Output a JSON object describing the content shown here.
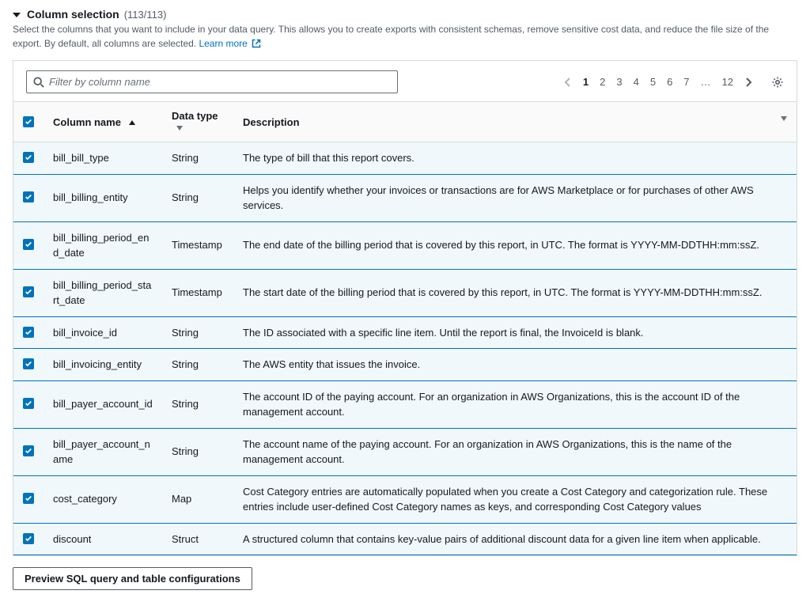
{
  "section": {
    "title": "Column selection",
    "count": "(113/113)",
    "description_pre": "Select the columns that you want to include in your data query. This allows you to create exports with consistent schemas, remove sensitive cost data, and reduce the file size of the export. By default, all columns are selected. ",
    "learn_more": "Learn more"
  },
  "search": {
    "placeholder": "Filter by column name"
  },
  "pagination": {
    "pages": [
      "1",
      "2",
      "3",
      "4",
      "5",
      "6",
      "7"
    ],
    "ellipsis": "…",
    "last": "12",
    "current_index": 0
  },
  "headers": {
    "column_name": "Column name",
    "data_type": "Data type",
    "description": "Description"
  },
  "rows": [
    {
      "name": "bill_bill_type",
      "type": "String",
      "desc": "The type of bill that this report covers."
    },
    {
      "name": "bill_billing_entity",
      "type": "String",
      "desc": "Helps you identify whether your invoices or transactions are for AWS Marketplace or for purchases of other AWS services."
    },
    {
      "name": "bill_billing_period_end_date",
      "type": "Timestamp",
      "desc": "The end date of the billing period that is covered by this report, in UTC. The format is YYYY-MM-DDTHH:mm:ssZ."
    },
    {
      "name": "bill_billing_period_start_date",
      "type": "Timestamp",
      "desc": "The start date of the billing period that is covered by this report, in UTC. The format is YYYY-MM-DDTHH:mm:ssZ."
    },
    {
      "name": "bill_invoice_id",
      "type": "String",
      "desc": "The ID associated with a specific line item. Until the report is final, the InvoiceId is blank."
    },
    {
      "name": "bill_invoicing_entity",
      "type": "String",
      "desc": "The AWS entity that issues the invoice."
    },
    {
      "name": "bill_payer_account_id",
      "type": "String",
      "desc": "The account ID of the paying account. For an organization in AWS Organizations, this is the account ID of the management account."
    },
    {
      "name": "bill_payer_account_name",
      "type": "String",
      "desc": "The account name of the paying account. For an organization in AWS Organizations, this is the name of the management account."
    },
    {
      "name": "cost_category",
      "type": "Map",
      "desc": "Cost Category entries are automatically populated when you create a Cost Category and categorization rule. These entries include user-defined Cost Category names as keys, and corresponding Cost Category values"
    },
    {
      "name": "discount",
      "type": "Struct",
      "desc": "A structured column that contains key-value pairs of additional discount data for a given line item when applicable."
    }
  ],
  "footer": {
    "preview_button": "Preview SQL query and table configurations"
  }
}
